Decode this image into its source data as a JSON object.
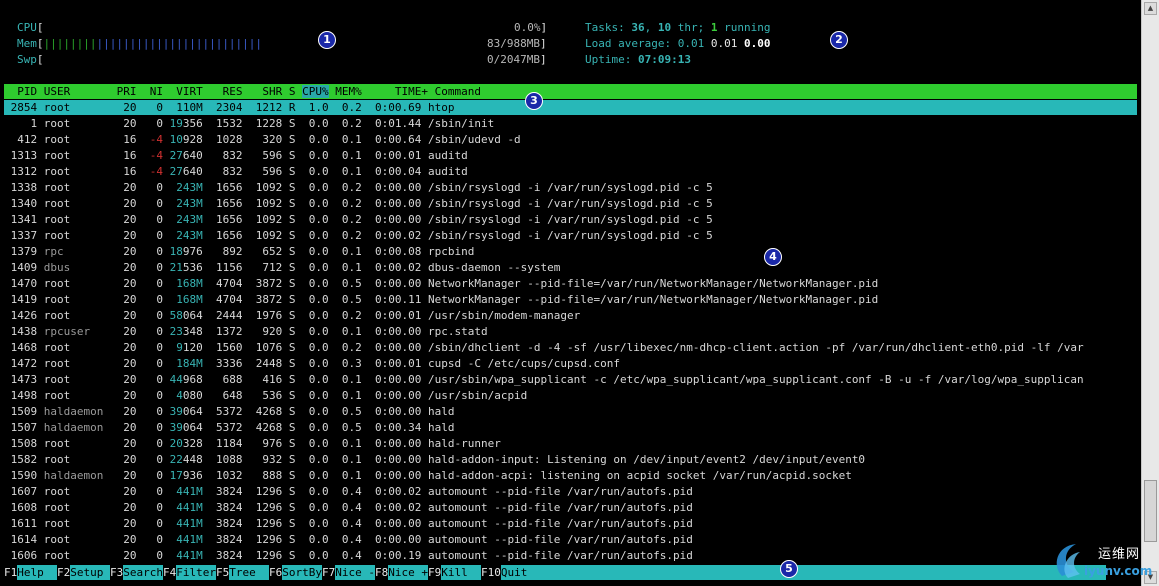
{
  "meters": {
    "cpu": {
      "label": "CPU",
      "open": "[",
      "bars": "",
      "value": "0.0%",
      "close": "]"
    },
    "mem": {
      "label": "Mem",
      "open": "[",
      "bars_green": "||||||||",
      "bars_blue": "|||||||||||||||||||||||||",
      "value": "83/988MB",
      "close": "]"
    },
    "swp": {
      "label": "Swp",
      "open": "[",
      "bars": "",
      "value": "0/2047MB",
      "close": "]"
    }
  },
  "info": {
    "tasks_label": "Tasks: ",
    "tasks_count": "36",
    "tasks_sep": ", ",
    "thr_count": "10",
    "thr_label": " thr; ",
    "running_count": "1",
    "running_label": " running",
    "load_label": "Load average: ",
    "load_1": "0.01",
    "load_5": "0.01",
    "load_15": "0.00",
    "uptime_label": "Uptime: ",
    "uptime_value": "07:09:13"
  },
  "columns": {
    "pid": "PID",
    "user": "USER",
    "pri": "PRI",
    "ni": "NI",
    "virt": "VIRT",
    "res": "RES",
    "shr": "SHR",
    "s": "S",
    "cpu": "CPU%",
    "mem": "MEM%",
    "time": "TIME+",
    "command": "Command"
  },
  "processes": [
    {
      "pid": "2854",
      "user": "root",
      "pri": "20",
      "ni": "0",
      "virt": "110M",
      "res": "2304",
      "shr": "1212",
      "s": "R",
      "cpu": "1.0",
      "mem": "0.2",
      "time": "0:00.69",
      "cmd": "htop"
    },
    {
      "pid": "1",
      "user": "root",
      "pri": "20",
      "ni": "0",
      "virt": "19356",
      "res": "1532",
      "shr": "1228",
      "s": "S",
      "cpu": "0.0",
      "mem": "0.2",
      "time": "0:01.44",
      "cmd": "/sbin/init"
    },
    {
      "pid": "412",
      "user": "root",
      "pri": "16",
      "ni": "-4",
      "virt": "10928",
      "res": "1028",
      "shr": "320",
      "s": "S",
      "cpu": "0.0",
      "mem": "0.1",
      "time": "0:00.64",
      "cmd": "/sbin/udevd -d"
    },
    {
      "pid": "1313",
      "user": "root",
      "pri": "16",
      "ni": "-4",
      "virt": "27640",
      "res": "832",
      "shr": "596",
      "s": "S",
      "cpu": "0.0",
      "mem": "0.1",
      "time": "0:00.01",
      "cmd": "auditd"
    },
    {
      "pid": "1312",
      "user": "root",
      "pri": "16",
      "ni": "-4",
      "virt": "27640",
      "res": "832",
      "shr": "596",
      "s": "S",
      "cpu": "0.0",
      "mem": "0.1",
      "time": "0:00.04",
      "cmd": "auditd"
    },
    {
      "pid": "1338",
      "user": "root",
      "pri": "20",
      "ni": "0",
      "virt": "243M",
      "res": "1656",
      "shr": "1092",
      "s": "S",
      "cpu": "0.0",
      "mem": "0.2",
      "time": "0:00.00",
      "cmd": "/sbin/rsyslogd -i /var/run/syslogd.pid -c 5"
    },
    {
      "pid": "1340",
      "user": "root",
      "pri": "20",
      "ni": "0",
      "virt": "243M",
      "res": "1656",
      "shr": "1092",
      "s": "S",
      "cpu": "0.0",
      "mem": "0.2",
      "time": "0:00.00",
      "cmd": "/sbin/rsyslogd -i /var/run/syslogd.pid -c 5"
    },
    {
      "pid": "1341",
      "user": "root",
      "pri": "20",
      "ni": "0",
      "virt": "243M",
      "res": "1656",
      "shr": "1092",
      "s": "S",
      "cpu": "0.0",
      "mem": "0.2",
      "time": "0:00.00",
      "cmd": "/sbin/rsyslogd -i /var/run/syslogd.pid -c 5"
    },
    {
      "pid": "1337",
      "user": "root",
      "pri": "20",
      "ni": "0",
      "virt": "243M",
      "res": "1656",
      "shr": "1092",
      "s": "S",
      "cpu": "0.0",
      "mem": "0.2",
      "time": "0:00.02",
      "cmd": "/sbin/rsyslogd -i /var/run/syslogd.pid -c 5"
    },
    {
      "pid": "1379",
      "user": "rpc",
      "pri": "20",
      "ni": "0",
      "virt": "18976",
      "res": "892",
      "shr": "652",
      "s": "S",
      "cpu": "0.0",
      "mem": "0.1",
      "time": "0:00.08",
      "cmd": "rpcbind"
    },
    {
      "pid": "1409",
      "user": "dbus",
      "pri": "20",
      "ni": "0",
      "virt": "21536",
      "res": "1156",
      "shr": "712",
      "s": "S",
      "cpu": "0.0",
      "mem": "0.1",
      "time": "0:00.02",
      "cmd": "dbus-daemon --system"
    },
    {
      "pid": "1470",
      "user": "root",
      "pri": "20",
      "ni": "0",
      "virt": "168M",
      "res": "4704",
      "shr": "3872",
      "s": "S",
      "cpu": "0.0",
      "mem": "0.5",
      "time": "0:00.00",
      "cmd": "NetworkManager --pid-file=/var/run/NetworkManager/NetworkManager.pid"
    },
    {
      "pid": "1419",
      "user": "root",
      "pri": "20",
      "ni": "0",
      "virt": "168M",
      "res": "4704",
      "shr": "3872",
      "s": "S",
      "cpu": "0.0",
      "mem": "0.5",
      "time": "0:00.11",
      "cmd": "NetworkManager --pid-file=/var/run/NetworkManager/NetworkManager.pid"
    },
    {
      "pid": "1426",
      "user": "root",
      "pri": "20",
      "ni": "0",
      "virt": "58064",
      "res": "2444",
      "shr": "1976",
      "s": "S",
      "cpu": "0.0",
      "mem": "0.2",
      "time": "0:00.01",
      "cmd": "/usr/sbin/modem-manager"
    },
    {
      "pid": "1438",
      "user": "rpcuser",
      "pri": "20",
      "ni": "0",
      "virt": "23348",
      "res": "1372",
      "shr": "920",
      "s": "S",
      "cpu": "0.0",
      "mem": "0.1",
      "time": "0:00.00",
      "cmd": "rpc.statd"
    },
    {
      "pid": "1468",
      "user": "root",
      "pri": "20",
      "ni": "0",
      "virt": "9120",
      "res": "1560",
      "shr": "1076",
      "s": "S",
      "cpu": "0.0",
      "mem": "0.2",
      "time": "0:00.00",
      "cmd": "/sbin/dhclient -d -4 -sf /usr/libexec/nm-dhcp-client.action -pf /var/run/dhclient-eth0.pid -lf /var"
    },
    {
      "pid": "1472",
      "user": "root",
      "pri": "20",
      "ni": "0",
      "virt": "184M",
      "res": "3336",
      "shr": "2448",
      "s": "S",
      "cpu": "0.0",
      "mem": "0.3",
      "time": "0:00.01",
      "cmd": "cupsd -C /etc/cups/cupsd.conf"
    },
    {
      "pid": "1473",
      "user": "root",
      "pri": "20",
      "ni": "0",
      "virt": "44968",
      "res": "688",
      "shr": "416",
      "s": "S",
      "cpu": "0.0",
      "mem": "0.1",
      "time": "0:00.00",
      "cmd": "/usr/sbin/wpa_supplicant -c /etc/wpa_supplicant/wpa_supplicant.conf -B -u -f /var/log/wpa_supplican"
    },
    {
      "pid": "1498",
      "user": "root",
      "pri": "20",
      "ni": "0",
      "virt": "4080",
      "res": "648",
      "shr": "536",
      "s": "S",
      "cpu": "0.0",
      "mem": "0.1",
      "time": "0:00.00",
      "cmd": "/usr/sbin/acpid"
    },
    {
      "pid": "1509",
      "user": "haldaemon",
      "pri": "20",
      "ni": "0",
      "virt": "39064",
      "res": "5372",
      "shr": "4268",
      "s": "S",
      "cpu": "0.0",
      "mem": "0.5",
      "time": "0:00.00",
      "cmd": "hald"
    },
    {
      "pid": "1507",
      "user": "haldaemon",
      "pri": "20",
      "ni": "0",
      "virt": "39064",
      "res": "5372",
      "shr": "4268",
      "s": "S",
      "cpu": "0.0",
      "mem": "0.5",
      "time": "0:00.34",
      "cmd": "hald"
    },
    {
      "pid": "1508",
      "user": "root",
      "pri": "20",
      "ni": "0",
      "virt": "20328",
      "res": "1184",
      "shr": "976",
      "s": "S",
      "cpu": "0.0",
      "mem": "0.1",
      "time": "0:00.00",
      "cmd": "hald-runner"
    },
    {
      "pid": "1582",
      "user": "root",
      "pri": "20",
      "ni": "0",
      "virt": "22448",
      "res": "1088",
      "shr": "932",
      "s": "S",
      "cpu": "0.0",
      "mem": "0.1",
      "time": "0:00.00",
      "cmd": "hald-addon-input: Listening on /dev/input/event2 /dev/input/event0"
    },
    {
      "pid": "1590",
      "user": "haldaemon",
      "pri": "20",
      "ni": "0",
      "virt": "17936",
      "res": "1032",
      "shr": "888",
      "s": "S",
      "cpu": "0.0",
      "mem": "0.1",
      "time": "0:00.00",
      "cmd": "hald-addon-acpi: listening on acpid socket /var/run/acpid.socket"
    },
    {
      "pid": "1607",
      "user": "root",
      "pri": "20",
      "ni": "0",
      "virt": "441M",
      "res": "3824",
      "shr": "1296",
      "s": "S",
      "cpu": "0.0",
      "mem": "0.4",
      "time": "0:00.02",
      "cmd": "automount --pid-file /var/run/autofs.pid"
    },
    {
      "pid": "1608",
      "user": "root",
      "pri": "20",
      "ni": "0",
      "virt": "441M",
      "res": "3824",
      "shr": "1296",
      "s": "S",
      "cpu": "0.0",
      "mem": "0.4",
      "time": "0:00.02",
      "cmd": "automount --pid-file /var/run/autofs.pid"
    },
    {
      "pid": "1611",
      "user": "root",
      "pri": "20",
      "ni": "0",
      "virt": "441M",
      "res": "3824",
      "shr": "1296",
      "s": "S",
      "cpu": "0.0",
      "mem": "0.4",
      "time": "0:00.00",
      "cmd": "automount --pid-file /var/run/autofs.pid"
    },
    {
      "pid": "1614",
      "user": "root",
      "pri": "20",
      "ni": "0",
      "virt": "441M",
      "res": "3824",
      "shr": "1296",
      "s": "S",
      "cpu": "0.0",
      "mem": "0.4",
      "time": "0:00.00",
      "cmd": "automount --pid-file /var/run/autofs.pid"
    },
    {
      "pid": "1606",
      "user": "root",
      "pri": "20",
      "ni": "0",
      "virt": "441M",
      "res": "3824",
      "shr": "1296",
      "s": "S",
      "cpu": "0.0",
      "mem": "0.4",
      "time": "0:00.19",
      "cmd": "automount --pid-file /var/run/autofs.pid"
    }
  ],
  "footer": [
    {
      "key": "F1",
      "label": "Help"
    },
    {
      "key": "F2",
      "label": "Setup"
    },
    {
      "key": "F3",
      "label": "Search"
    },
    {
      "key": "F4",
      "label": "Filter"
    },
    {
      "key": "F5",
      "label": "Tree"
    },
    {
      "key": "F6",
      "label": "SortBy"
    },
    {
      "key": "F7",
      "label": "Nice -"
    },
    {
      "key": "F8",
      "label": "Nice +"
    },
    {
      "key": "F9",
      "label": "Kill"
    },
    {
      "key": "F10",
      "label": "Quit"
    }
  ],
  "badges": [
    "1",
    "2",
    "3",
    "4",
    "5"
  ],
  "watermark": {
    "text": "运维网",
    "sub": "iyunv.com"
  },
  "colors": {
    "header_bar": "#2fcc2f",
    "selection": "#28b8b8",
    "label_cyan": "#38b4b4",
    "nice_red": "#d03030",
    "badge_blue": "#1a28a8"
  }
}
